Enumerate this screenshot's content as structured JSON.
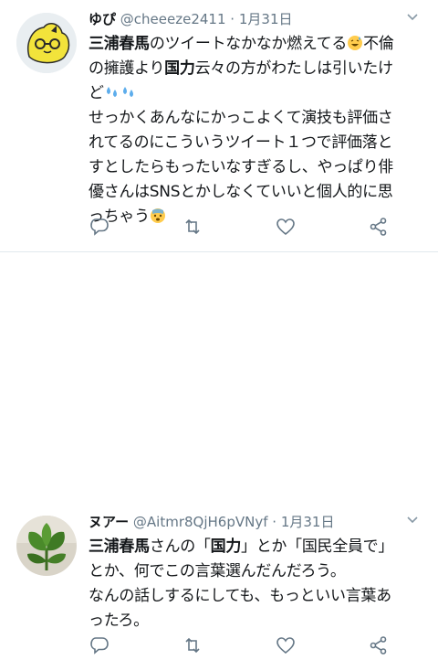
{
  "tweets": [
    {
      "name": "ゆぴ",
      "handle": "@cheeeze2411",
      "dot": "·",
      "date": "1月31日",
      "lines": [
        "三浦春馬のツイートなかなか燃えてる",
        "不倫",
        "の擁護より国力云々の方がわたしは引いたけ",
        "ど",
        "せっかくあんなにかっこよくて演技も評価さ",
        "れてるのにこういうツイート１つで評価落と",
        "すとしたらもったいなすぎるし、やっぱり俳",
        "優さんはSNSとかしなくていいと個人的に思",
        "っちゃう"
      ],
      "bold_phrases": [
        "三浦春馬",
        "国力"
      ],
      "emojis": [
        "grinning-sweat-emoji",
        "sweat-droplets-emoji",
        "sweat-droplets-emoji",
        "fearful-face-emoji"
      ]
    },
    {
      "name": "ヌアー",
      "handle": "@Aitmr8QjH6pVNyf",
      "dot": "·",
      "date": "1月31日",
      "lines": [
        "三浦春馬さんの「国力」とか「国民全員で」",
        "とか、何でこの言葉選んだんだろう。",
        "なんの話しするにしても、もっといい言葉あ",
        "ったろ。"
      ],
      "bold_phrases": [
        "三浦春馬",
        "国力"
      ]
    }
  ],
  "actions": [
    "reply-icon",
    "retweet-icon",
    "like-icon",
    "share-icon"
  ],
  "colors": {
    "icon": "#657786",
    "separator": "#e1e8ed",
    "avatar1_face": "#f2e33b",
    "text": "#14171a"
  }
}
